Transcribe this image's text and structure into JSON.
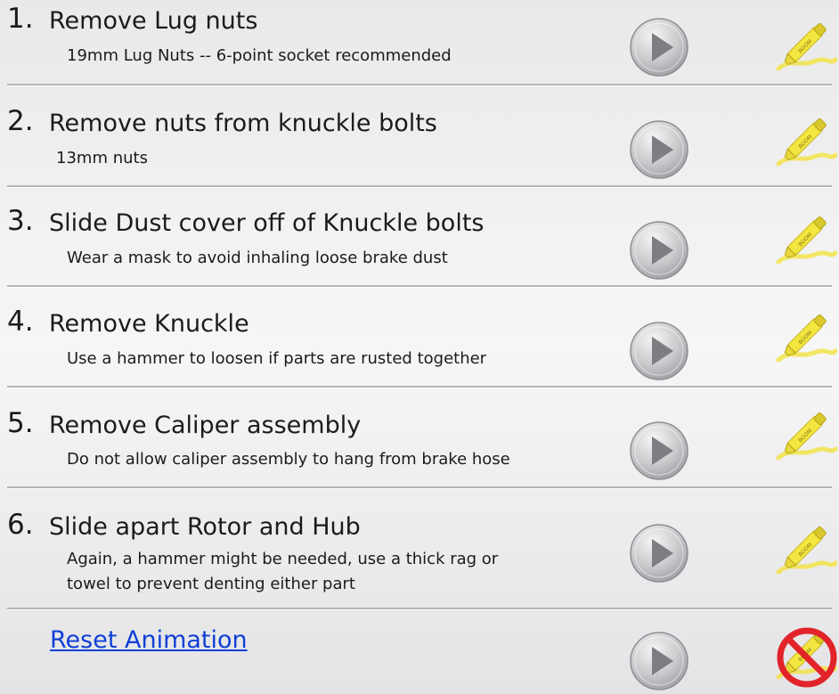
{
  "steps": [
    {
      "num": "1.",
      "title": "Remove Lug nuts",
      "lines": [
        "19mm Lug Nuts -- 6-point socket recommended"
      ]
    },
    {
      "num": "2.",
      "title": "Remove nuts from knuckle bolts",
      "lines": [
        "13mm nuts"
      ]
    },
    {
      "num": "3.",
      "title": "Slide Dust cover off of Knuckle bolts",
      "lines": [
        "Wear a mask to avoid inhaling loose brake dust"
      ]
    },
    {
      "num": "4.",
      "title": "Remove Knuckle",
      "lines": [
        "Use a hammer to loosen if parts are rusted together"
      ]
    },
    {
      "num": "5.",
      "title": "Remove Caliper assembly",
      "lines": [
        "Do not allow caliper assembly to hang from brake hose"
      ]
    },
    {
      "num": "6.",
      "title": "Slide apart Rotor and Hub",
      "lines": [
        "Again, a hammer might be needed, use a thick rag or",
        "towel to prevent denting either part"
      ]
    }
  ],
  "reset_label": "Reset Animation",
  "highlighter_text": "BOOM",
  "icons": {
    "play": "play-icon",
    "highlighter": "highlighter-icon",
    "disabled": "no-symbol-icon"
  },
  "colors": {
    "play_button": "#c8c9cb",
    "highlighter": "#f4e640",
    "stroke_yellow": "#f2e34a",
    "no_symbol": "#e2232a",
    "link": "#0f3fd6"
  }
}
